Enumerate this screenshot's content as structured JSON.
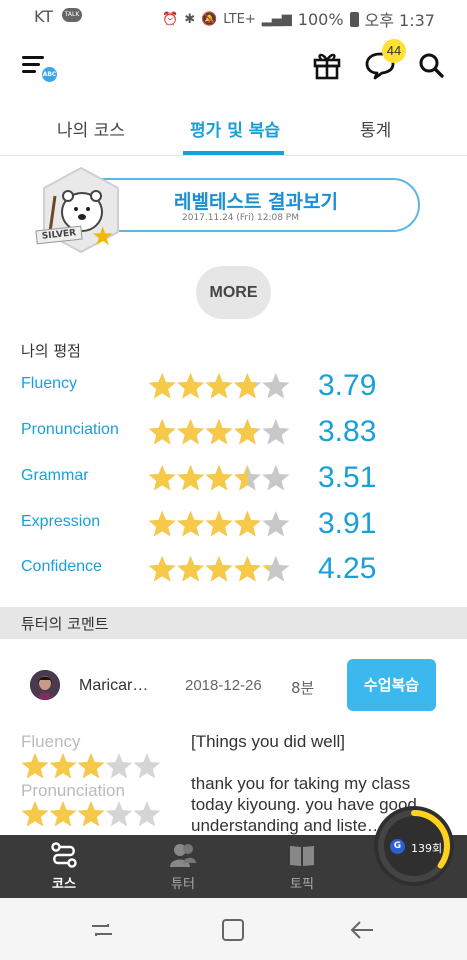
{
  "status_bar": {
    "carrier": "KT",
    "talk_icon": "TALK",
    "network": "LTE+",
    "battery": "100%",
    "time": "오후 1:37"
  },
  "app_bar": {
    "menu_badge": "ABC",
    "chat_badge_count": "44"
  },
  "tabs": [
    {
      "label": "나의 코스",
      "active": false
    },
    {
      "label": "평가 및 복습",
      "active": true
    },
    {
      "label": "통계",
      "active": false
    }
  ],
  "level_test": {
    "title": "레벨테스트 결과보기",
    "date": "2017.11.24 (Fri) 12:08 PM",
    "level_badge": "SILVER"
  },
  "more_button": "MORE",
  "my_rating": {
    "title": "나의 평점",
    "items": [
      {
        "label": "Fluency",
        "value": "3.79",
        "stars": 3.79
      },
      {
        "label": "Pronunciation",
        "value": "3.83",
        "stars": 3.83
      },
      {
        "label": "Grammar",
        "value": "3.51",
        "stars": 3.51
      },
      {
        "label": "Expression",
        "value": "3.91",
        "stars": 3.91
      },
      {
        "label": "Confidence",
        "value": "4.25",
        "stars": 4.25
      }
    ]
  },
  "comments": {
    "section_title": "튜터의 코멘트",
    "tutor_name": "Maricar…",
    "date": "2018-12-26",
    "duration": "8분",
    "review_button": "수업복습",
    "mini_ratings": [
      {
        "label": "Fluency",
        "stars": 3
      },
      {
        "label": "Pronunciation",
        "stars": 3
      }
    ],
    "text_line1": "[Things you did well]",
    "text_line2": "thank you for taking my class",
    "text_line3": "today kiyoung. you have good",
    "text_line4": "understanding and liste…"
  },
  "bottom_nav": [
    {
      "label": "코스",
      "icon": "course-icon",
      "active": true
    },
    {
      "label": "튜터",
      "icon": "tutor-icon",
      "active": false
    },
    {
      "label": "토픽",
      "icon": "book-icon",
      "active": false
    }
  ],
  "lesson_counter": {
    "g_label": "G",
    "count": "139회",
    "progress": 0.35
  },
  "colors": {
    "accent": "#1aa0d8",
    "star": "#f7c948",
    "star_empty": "#c8c8c8",
    "button": "#3cb8ef"
  }
}
